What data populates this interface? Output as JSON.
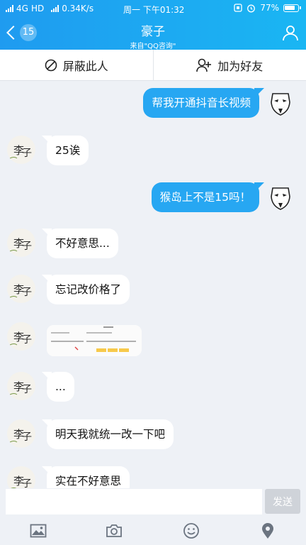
{
  "status": {
    "network": "4G",
    "hd": "HD",
    "speed": "0.34K/s",
    "day_time": "周一 下午01:32",
    "battery": "77%"
  },
  "header": {
    "unread_badge": "15",
    "title": "豪子",
    "subtitle": "来自\"QQ咨询\""
  },
  "actions": {
    "block_label": "屏蔽此人",
    "add_friend_label": "加为好友"
  },
  "messages": [
    {
      "side": "right",
      "text": "帮我开通抖音长视频"
    },
    {
      "side": "left",
      "text": "25诶"
    },
    {
      "side": "right",
      "text": "猴岛上不是15吗！"
    },
    {
      "side": "left",
      "text": "不好意思..."
    },
    {
      "side": "left",
      "text": "忘记改价格了"
    },
    {
      "side": "left",
      "type": "image"
    },
    {
      "side": "left",
      "text": "..."
    },
    {
      "side": "left",
      "text": "明天我就统一改一下吧"
    },
    {
      "side": "left",
      "text": "实在不好意思"
    }
  ],
  "input": {
    "value": "",
    "send_label": "发送"
  },
  "toolbar": [
    "image-icon",
    "camera-icon",
    "emoji-icon",
    "location-icon"
  ],
  "colors": {
    "header": "#1ea6f2",
    "bubble_self": "#27a7f2",
    "bubble_other": "#ffffff",
    "background": "#eef1f6"
  }
}
